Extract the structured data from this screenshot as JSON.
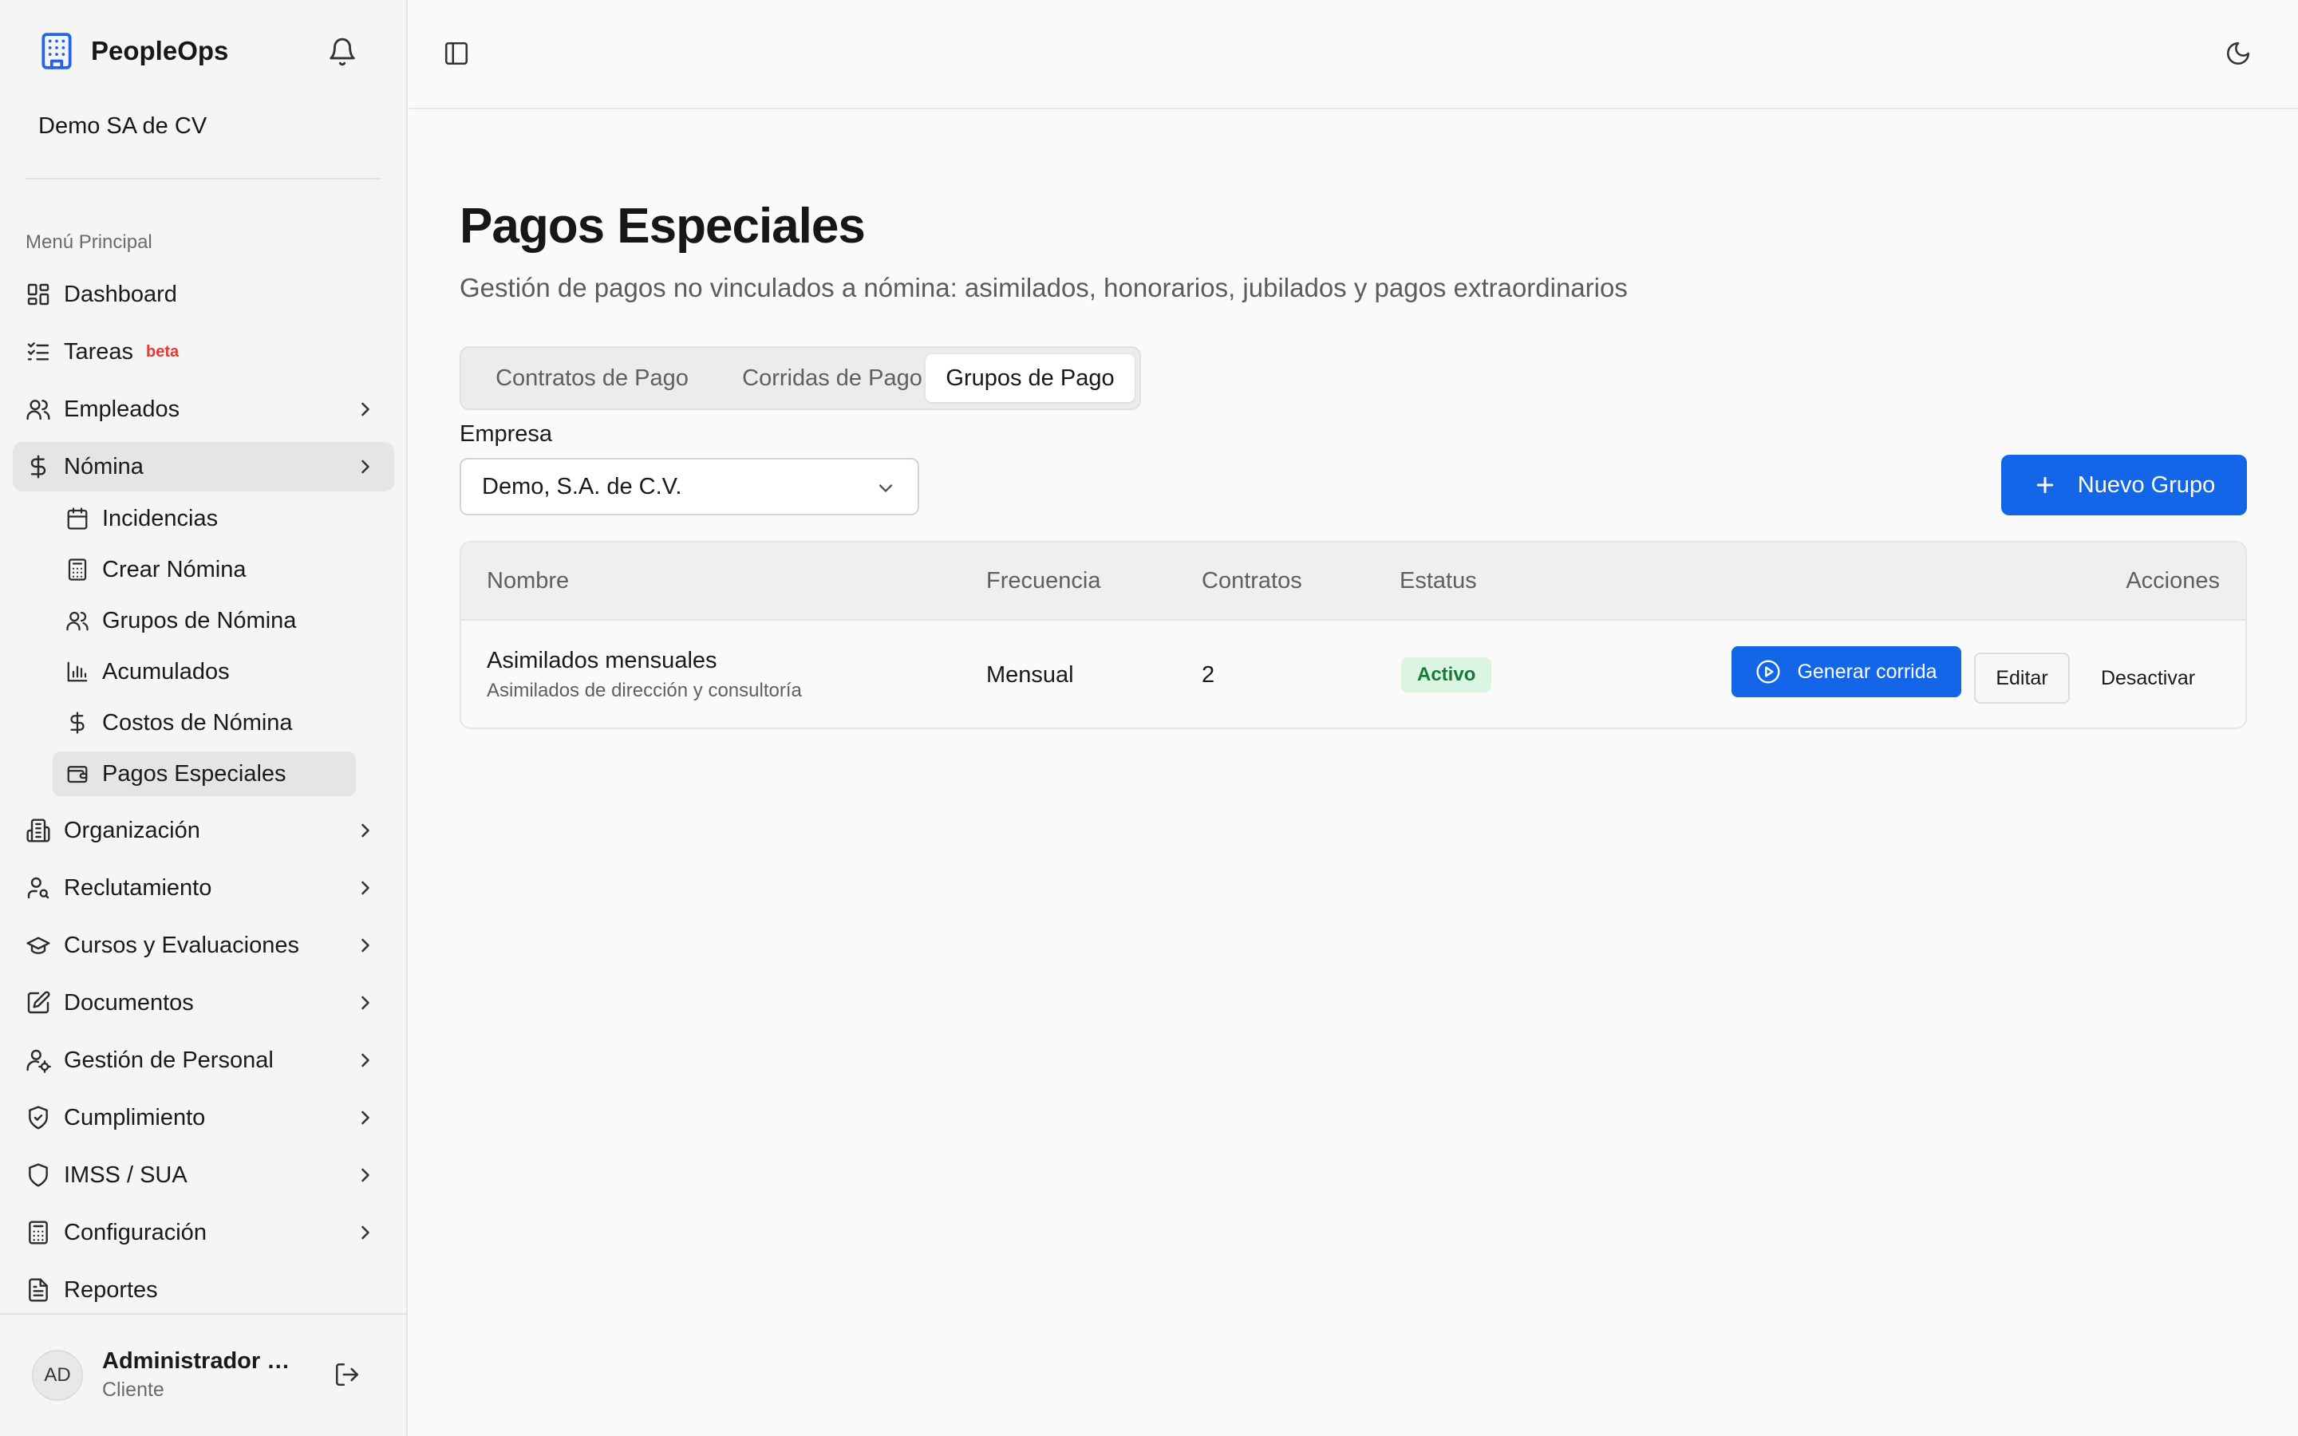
{
  "app": {
    "name": "PeopleOps",
    "company": "Demo SA de CV"
  },
  "sidebar": {
    "menu_title": "Menú Principal",
    "items": [
      {
        "label": "Dashboard",
        "icon": "dashboard-icon"
      },
      {
        "label": "Tareas",
        "badge": "beta",
        "icon": "tasks-icon"
      },
      {
        "label": "Empleados",
        "icon": "users-icon"
      },
      {
        "label": "Nómina",
        "icon": "dollar-icon",
        "expanded": true
      },
      {
        "label": "Organización",
        "icon": "building-icon"
      },
      {
        "label": "Reclutamiento",
        "icon": "user-search-icon"
      },
      {
        "label": "Cursos y Evaluaciones",
        "icon": "graduation-cap-icon"
      },
      {
        "label": "Documentos",
        "icon": "document-edit-icon"
      },
      {
        "label": "Gestión de Personal",
        "icon": "user-cog-icon"
      },
      {
        "label": "Cumplimiento",
        "icon": "shield-check-icon"
      },
      {
        "label": "IMSS / SUA",
        "icon": "shield-icon"
      },
      {
        "label": "Configuración",
        "icon": "calculator-icon"
      },
      {
        "label": "Reportes",
        "icon": "file-text-icon"
      }
    ],
    "sub_items": [
      {
        "label": "Incidencias",
        "icon": "calendar-icon"
      },
      {
        "label": "Crear Nómina",
        "icon": "calculator-icon"
      },
      {
        "label": "Grupos de Nómina",
        "icon": "users-icon"
      },
      {
        "label": "Acumulados",
        "icon": "bar-chart-icon"
      },
      {
        "label": "Costos de Nómina",
        "icon": "dollar-icon"
      },
      {
        "label": "Pagos Especiales",
        "icon": "wallet-icon",
        "active": true
      }
    ]
  },
  "user": {
    "initials": "AD",
    "name": "Administrador Demo",
    "role": "Cliente"
  },
  "page": {
    "title": "Pagos Especiales",
    "subtitle": "Gestión de pagos no vinculados a nómina: asimilados, honorarios, jubilados y pagos extraordinarios"
  },
  "tabs": [
    {
      "label": "Contratos de Pago"
    },
    {
      "label": "Corridas de Pago"
    },
    {
      "label": "Grupos de Pago",
      "active": true
    }
  ],
  "filter": {
    "label": "Empresa",
    "value": "Demo, S.A. de C.V."
  },
  "new_group_button": "Nuevo Grupo",
  "table": {
    "columns": [
      "Nombre",
      "Frecuencia",
      "Contratos",
      "Estatus",
      "Acciones"
    ],
    "rows": [
      {
        "name": "Asimilados mensuales",
        "description": "Asimilados de dirección y consultoría",
        "frequency": "Mensual",
        "contracts": "2",
        "status": "Activo",
        "actions": {
          "run": "Generar corrida",
          "edit": "Editar",
          "deactivate": "Desactivar"
        }
      }
    ]
  },
  "colors": {
    "primary": "#1466e8",
    "status_active_bg": "#dcf5e3",
    "status_active_text": "#16793a",
    "beta": "#e53935"
  }
}
